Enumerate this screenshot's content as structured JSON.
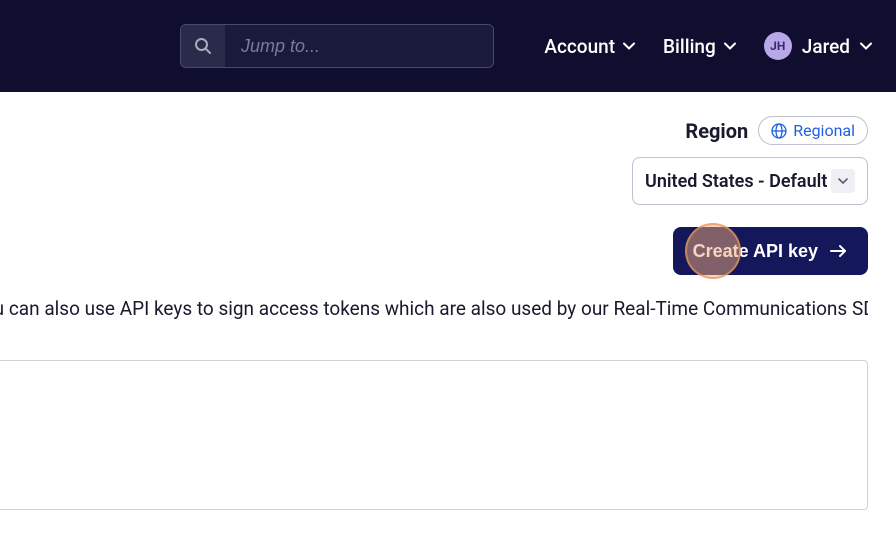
{
  "header": {
    "search_placeholder": "Jump to...",
    "nav": {
      "account": "Account",
      "billing": "Billing"
    },
    "user": {
      "initials": "JH",
      "name": "Jared"
    }
  },
  "region": {
    "label": "Region",
    "badge": "Regional",
    "selected": "United States - Default"
  },
  "actions": {
    "create_api_key": "Create API key"
  },
  "description": "You can also use API keys to sign access tokens which are also used by our Real-Time Communications SDKs."
}
